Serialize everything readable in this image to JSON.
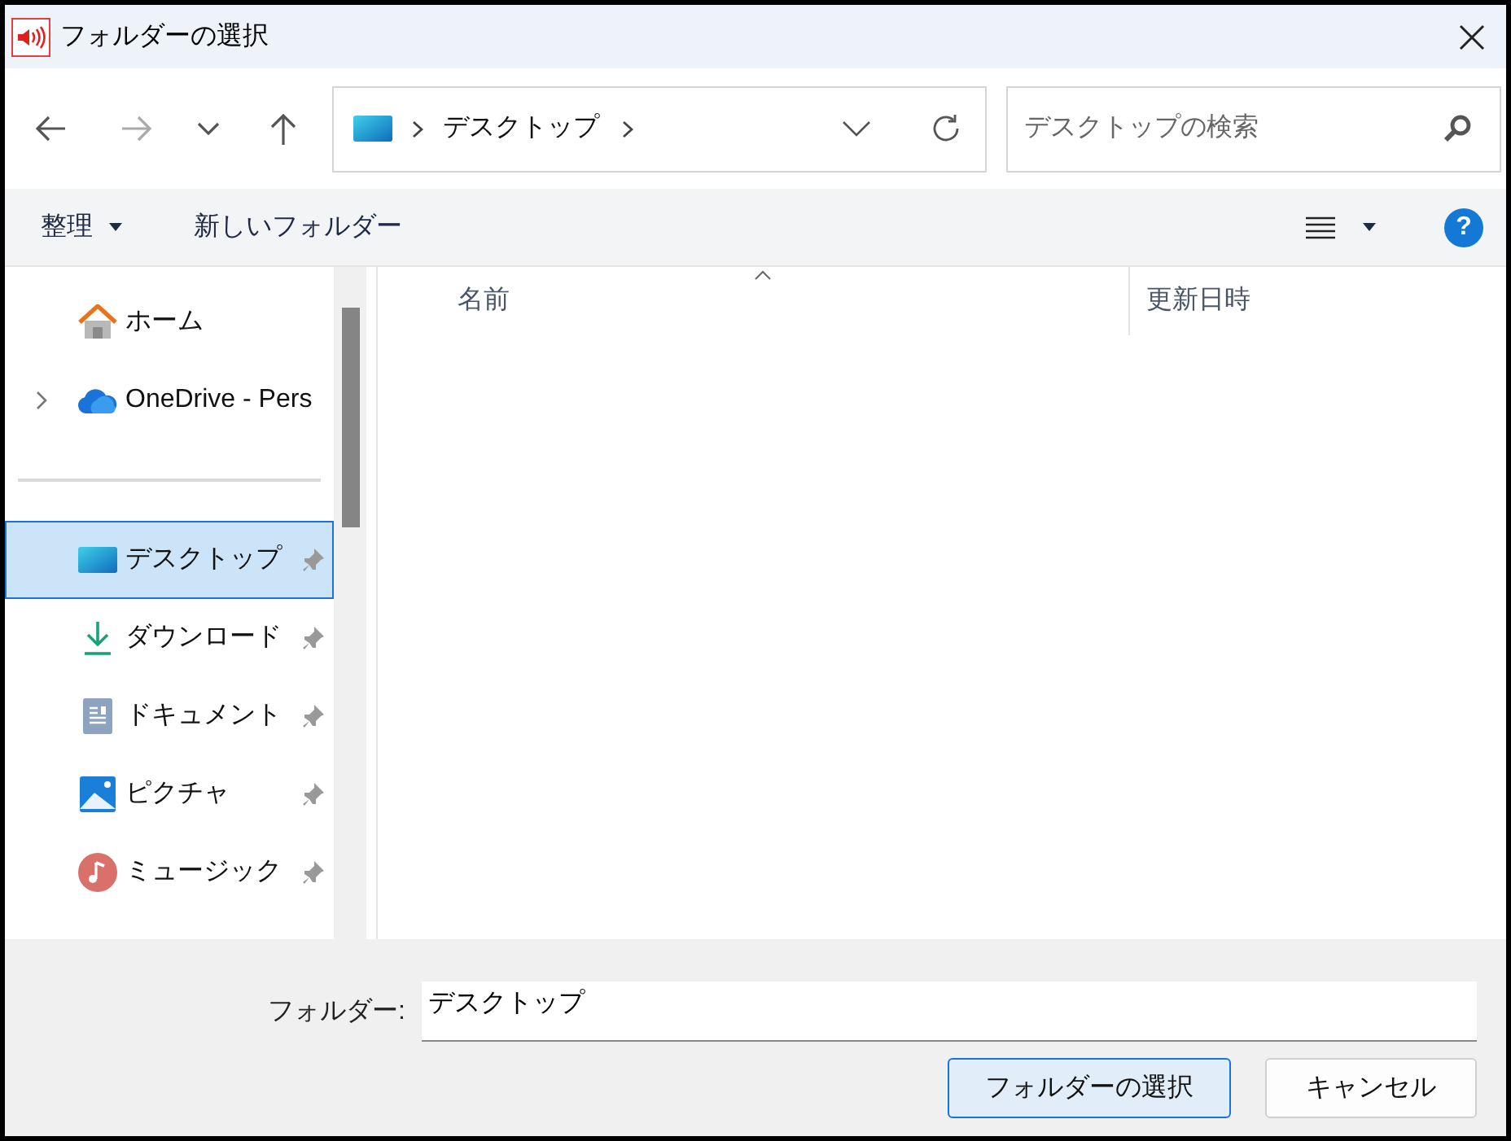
{
  "window": {
    "title": "フォルダーの選択"
  },
  "nav": [
    {
      "kind": "back",
      "disabled": false
    },
    {
      "kind": "forward",
      "disabled": true
    },
    {
      "kind": "recent",
      "disabled": false
    },
    {
      "kind": "up",
      "disabled": false
    }
  ],
  "address": {
    "segments": [
      "デスクトップ"
    ]
  },
  "search": {
    "placeholder": "デスクトップの検索"
  },
  "toolbar": {
    "organize": "整理",
    "new_folder": "新しいフォルダー",
    "help": "?"
  },
  "sidebar": {
    "sections": [
      {
        "items": [
          {
            "label": "ホーム",
            "kind": "home",
            "expandable": false,
            "pinned": false,
            "selected": false
          },
          {
            "label": "OneDrive - Pers",
            "kind": "cloud",
            "expandable": true,
            "pinned": false,
            "selected": false
          }
        ]
      },
      {
        "items": [
          {
            "label": "デスクトップ",
            "kind": "desktop",
            "expandable": false,
            "pinned": true,
            "selected": true
          },
          {
            "label": "ダウンロード",
            "kind": "download",
            "expandable": false,
            "pinned": true,
            "selected": false
          },
          {
            "label": "ドキュメント",
            "kind": "document",
            "expandable": false,
            "pinned": true,
            "selected": false
          },
          {
            "label": "ピクチャ",
            "kind": "picture",
            "expandable": false,
            "pinned": true,
            "selected": false
          },
          {
            "label": "ミュージック",
            "kind": "music",
            "expandable": false,
            "pinned": true,
            "selected": false
          }
        ]
      }
    ]
  },
  "table": {
    "columns": [
      {
        "label": "名前",
        "sorted": true
      },
      {
        "label": "更新日時",
        "sorted": false
      }
    ]
  },
  "footer": {
    "folder_label": "フォルダー:",
    "folder_value": "デスクトップ",
    "buttons": [
      {
        "label": "フォルダーの選択",
        "primary": true
      },
      {
        "label": "キャンセル",
        "primary": false
      }
    ]
  }
}
